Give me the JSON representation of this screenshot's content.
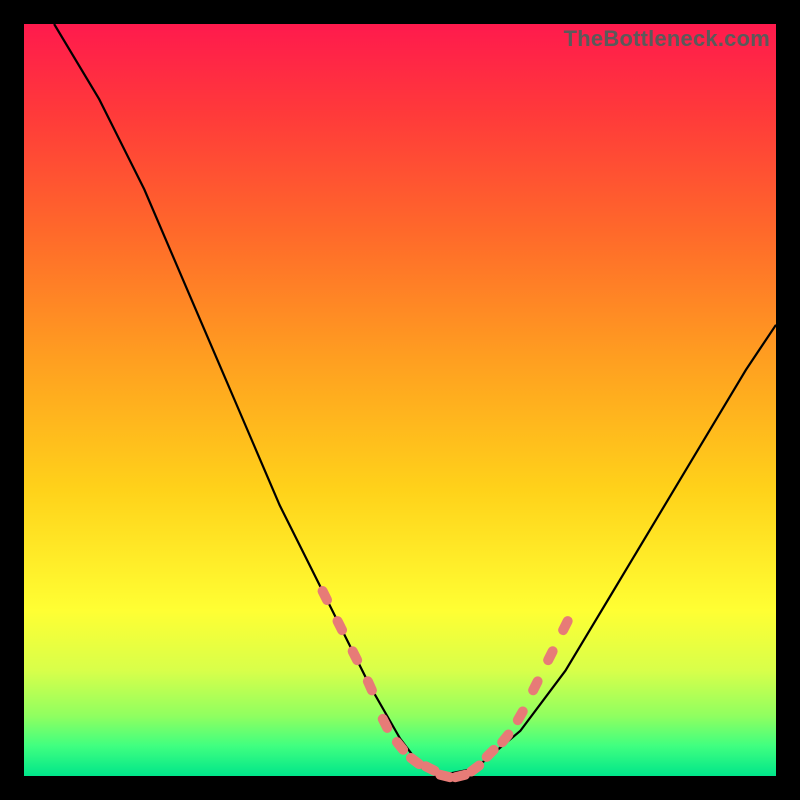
{
  "watermark": "TheBottleneck.com",
  "chart_data": {
    "type": "line",
    "title": "",
    "xlabel": "",
    "ylabel": "",
    "xlim": [
      0,
      100
    ],
    "ylim": [
      0,
      100
    ],
    "grid": false,
    "legend": false,
    "background_gradient": {
      "top": "#ff1a4d",
      "bottom": "#00e68a"
    },
    "series": [
      {
        "name": "left-curve",
        "x": [
          4,
          10,
          16,
          22,
          28,
          34,
          40,
          46,
          50,
          53,
          55
        ],
        "y": [
          100,
          90,
          78,
          64,
          50,
          36,
          24,
          12,
          5,
          1,
          0
        ]
      },
      {
        "name": "right-curve",
        "x": [
          55,
          60,
          66,
          72,
          78,
          84,
          90,
          96,
          100
        ],
        "y": [
          0,
          1,
          6,
          14,
          24,
          34,
          44,
          54,
          60
        ]
      }
    ],
    "markers": {
      "color": "#e77b77",
      "shape": "rounded-capsule",
      "points": [
        {
          "x": 40,
          "y": 24
        },
        {
          "x": 42,
          "y": 20
        },
        {
          "x": 44,
          "y": 16
        },
        {
          "x": 46,
          "y": 12
        },
        {
          "x": 48,
          "y": 7
        },
        {
          "x": 50,
          "y": 4
        },
        {
          "x": 52,
          "y": 2
        },
        {
          "x": 54,
          "y": 1
        },
        {
          "x": 56,
          "y": 0
        },
        {
          "x": 58,
          "y": 0
        },
        {
          "x": 60,
          "y": 1
        },
        {
          "x": 62,
          "y": 3
        },
        {
          "x": 64,
          "y": 5
        },
        {
          "x": 66,
          "y": 8
        },
        {
          "x": 68,
          "y": 12
        },
        {
          "x": 70,
          "y": 16
        },
        {
          "x": 72,
          "y": 20
        }
      ]
    },
    "annotations": []
  }
}
